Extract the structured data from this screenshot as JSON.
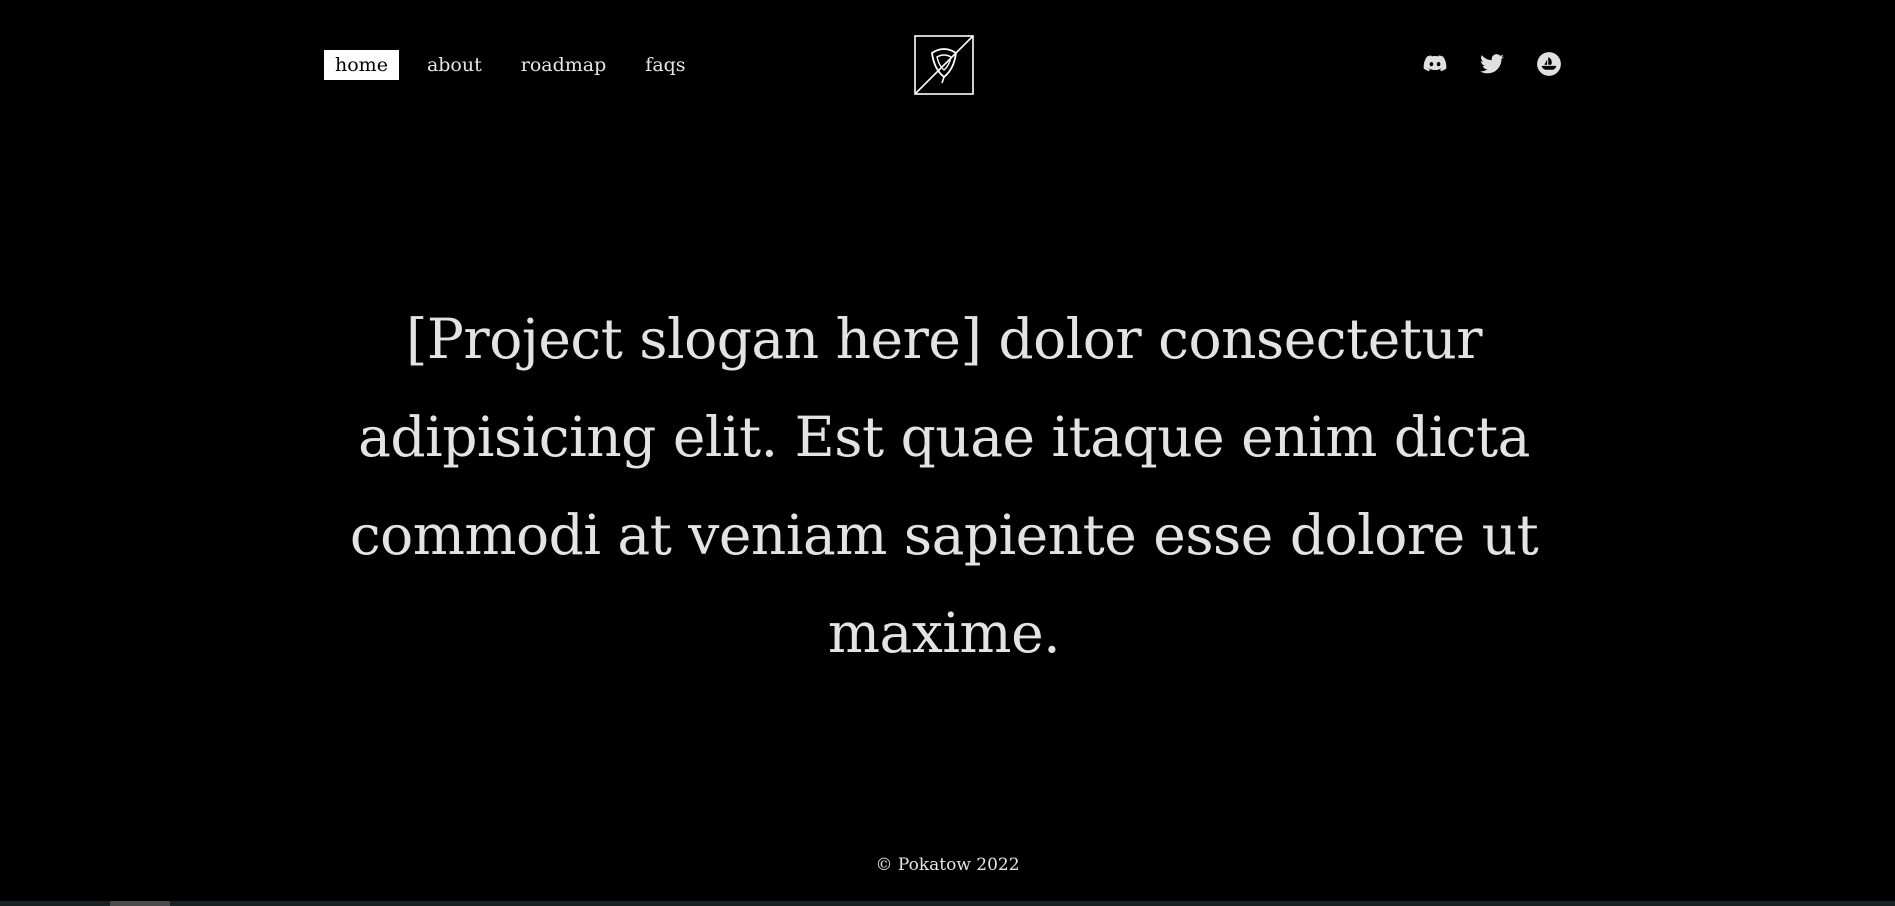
{
  "nav": {
    "items": [
      {
        "label": "home",
        "active": true
      },
      {
        "label": "about",
        "active": false
      },
      {
        "label": "roadmap",
        "active": false
      },
      {
        "label": "faqs",
        "active": false
      }
    ]
  },
  "logo": {
    "icon": "project-logo-icon"
  },
  "socials": [
    {
      "icon": "discord-icon"
    },
    {
      "icon": "twitter-icon"
    },
    {
      "icon": "opensea-icon"
    }
  ],
  "hero": {
    "slogan": "[Project slogan here] dolor consectetur adipisicing elit. Est quae itaque enim dicta commodi at veniam sapiente esse dolore ut maxime."
  },
  "footer": {
    "copyright": "© Pokatow 2022"
  },
  "colors": {
    "background": "#000000",
    "text": "#e6e6e6",
    "active_nav_bg": "#ffffff",
    "active_nav_text": "#000000"
  }
}
